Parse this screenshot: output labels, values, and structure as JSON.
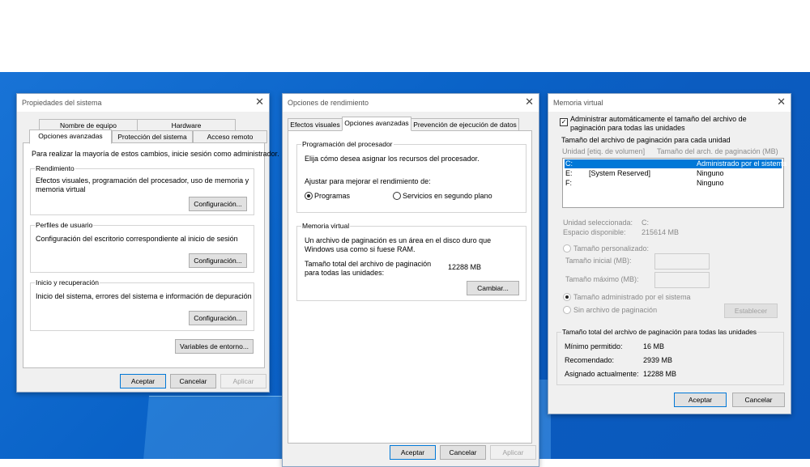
{
  "sysprops": {
    "title": "Propiedades del sistema",
    "tabs_row1": [
      "Nombre de equipo",
      "Hardware"
    ],
    "tabs_row2": [
      "Opciones avanzadas",
      "Protección del sistema",
      "Acceso remoto"
    ],
    "admin_note": "Para realizar la mayoría de estos cambios, inicie sesión como administrador.",
    "performance": {
      "legend": "Rendimiento",
      "desc1": "Efectos visuales, programación del procesador, uso de memoria y",
      "desc2": "memoria virtual",
      "button": "Configuración..."
    },
    "profiles": {
      "legend": "Perfiles de usuario",
      "desc": "Configuración del escritorio correspondiente al inicio de sesión",
      "button": "Configuración..."
    },
    "startup": {
      "legend": "Inicio y recuperación",
      "desc": "Inicio del sistema, errores del sistema e información de depuración",
      "button": "Configuración..."
    },
    "env_button": "Variables de entorno...",
    "ok": "Aceptar",
    "cancel": "Cancelar",
    "apply": "Aplicar"
  },
  "perf": {
    "title": "Opciones de rendimiento",
    "tabs": [
      "Efectos visuales",
      "Opciones avanzadas",
      "Prevención de ejecución de datos"
    ],
    "sched": {
      "legend": "Programación del procesador",
      "desc": "Elija cómo desea asignar los recursos del procesador.",
      "adjust": "Ajustar para mejorar el rendimiento de:",
      "opt_programs": "Programas",
      "opt_services": "Servicios en segundo plano"
    },
    "vm": {
      "legend": "Memoria virtual",
      "desc1": "Un archivo de paginación es un área en el disco duro que",
      "desc2": "Windows usa como si fuese RAM.",
      "total1": "Tamaño total del archivo de paginación",
      "total2": "para todas las unidades:",
      "total_value": "12288 MB",
      "button": "Cambiar..."
    },
    "ok": "Aceptar",
    "cancel": "Cancelar",
    "apply": "Aplicar"
  },
  "vmwin": {
    "title": "Memoria virtual",
    "auto1": "Administrar automáticamente el tamaño del archivo de",
    "auto2": "paginación para todas las unidades",
    "group_label": "Tamaño del archivo de paginación para cada unidad",
    "col_drive": "Unidad [etiq. de volumen]",
    "col_size": "Tamaño del arch. de paginación (MB)",
    "rows": [
      {
        "drive": "C:",
        "label": "",
        "size": "Administrado por el sistema"
      },
      {
        "drive": "E:",
        "label": "[System Reserved]",
        "size": "Ninguno"
      },
      {
        "drive": "F:",
        "label": "",
        "size": "Ninguno"
      }
    ],
    "sel_drive_label": "Unidad seleccionada:",
    "sel_drive_value": "C:",
    "free_label": "Espacio disponible:",
    "free_value": "215614 MB",
    "custom": "Tamaño personalizado:",
    "initial": "Tamaño inicial (MB):",
    "max": "Tamaño máximo (MB):",
    "system_managed": "Tamaño administrado por el sistema",
    "no_paging": "Sin archivo de paginación",
    "set_button": "Establecer",
    "total_label": "Tamaño total del archivo de paginación para todas las unidades",
    "min_label": "Mínimo permitido:",
    "min_value": "16 MB",
    "rec_label": "Recomendado:",
    "rec_value": "2939 MB",
    "cur_label": "Asignado actualmente:",
    "cur_value": "12288 MB",
    "ok": "Aceptar",
    "cancel": "Cancelar"
  }
}
